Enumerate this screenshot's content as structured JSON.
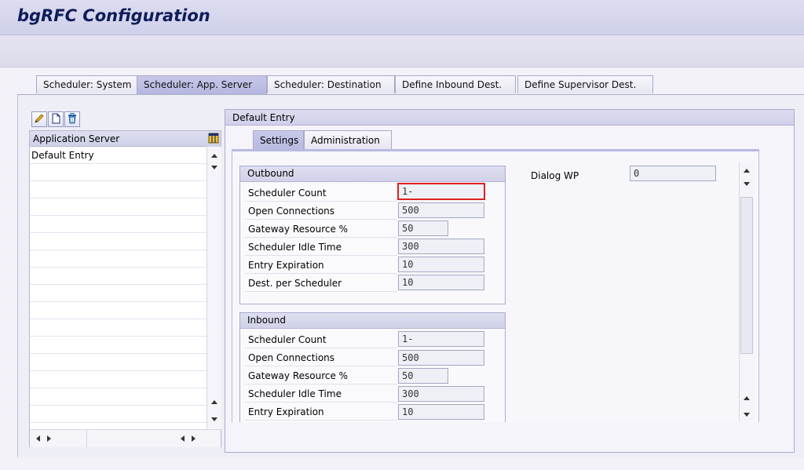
{
  "app": {
    "title": "bgRFC Configuration"
  },
  "top_tabs": [
    {
      "label": "Scheduler: System",
      "active": false
    },
    {
      "label": "Scheduler: App. Server",
      "active": true
    },
    {
      "label": "Scheduler: Destination",
      "active": false
    },
    {
      "label": "Define Inbound Dest.",
      "active": false
    },
    {
      "label": "Define Supervisor Dest.",
      "active": false
    }
  ],
  "toolbar_icons": [
    "pencil-icon",
    "new-document-icon",
    "trash-icon"
  ],
  "left_table": {
    "header": "Application Server",
    "rows": [
      "Default Entry"
    ]
  },
  "detail": {
    "header": "Default Entry",
    "sub_tabs": [
      {
        "label": "Settings",
        "active": true
      },
      {
        "label": "Administration",
        "active": false
      }
    ],
    "outbound": {
      "title": "Outbound",
      "fields": [
        {
          "label": "Scheduler Count",
          "value": "1-"
        },
        {
          "label": "Open Connections",
          "value": "500"
        },
        {
          "label": "Gateway Resource %",
          "value": "50"
        },
        {
          "label": "Scheduler Idle Time",
          "value": "300"
        },
        {
          "label": "Entry Expiration",
          "value": "10"
        },
        {
          "label": "Dest. per Scheduler",
          "value": "10"
        }
      ]
    },
    "inbound": {
      "title": "Inbound",
      "fields": [
        {
          "label": "Scheduler Count",
          "value": "1-"
        },
        {
          "label": "Open Connections",
          "value": "500"
        },
        {
          "label": "Gateway Resource %",
          "value": "50"
        },
        {
          "label": "Scheduler Idle Time",
          "value": "300"
        },
        {
          "label": "Entry Expiration",
          "value": "10"
        }
      ]
    },
    "dialog_wp": {
      "label": "Dialog WP",
      "value": "0"
    }
  },
  "colors": {
    "title_text": "#0f1c5a",
    "active_tab": "#b6b7e0",
    "focus_border": "#e02020"
  }
}
